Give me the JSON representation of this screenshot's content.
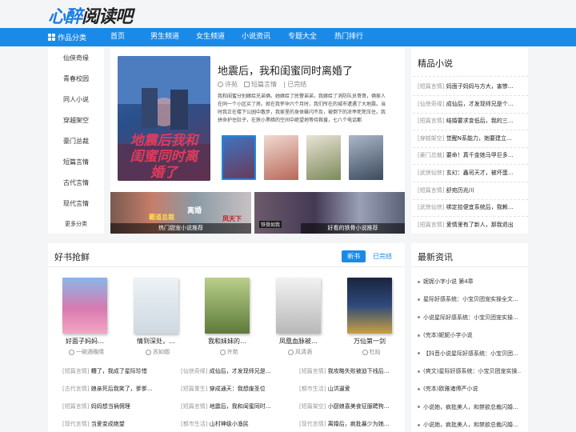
{
  "logo": {
    "part1": "心醉",
    "part2": "阅读吧"
  },
  "nav": {
    "category": "作品分类",
    "items": [
      "首页",
      "男生频道",
      "女生频道",
      "小说资讯",
      "专题大全",
      "热门排行"
    ]
  },
  "sidebar": {
    "items": [
      "仙侠奇缘",
      "青春校园",
      "同人小说",
      "穿越架空",
      "豪门总裁",
      "短篇言情",
      "古代言情",
      "现代言情",
      "更多分类"
    ]
  },
  "hero": {
    "title": "地震后，我和闺蜜同时离婚了",
    "author": "许苑",
    "category": "短篇言情",
    "status": "已完结",
    "desc": "我和闺蜜分别嫁给兄弟俩。她嫁给了民警弟弟，我嫁给了消防队员哥哥，俩家人在同一个小区买了房。就在我怀孕六个月时，我们所在的城市遭遇了大地震。当时我正在楼下公园中散步，我家里的身体躲闪不及，被倒下的凉亭死死压住。我拼命护住肚子，在狭小黑暗的空间中绝望地等待救援，七八个电话都",
    "cover_text": "地震后我和闺蜜同时离婚了"
  },
  "banners": [
    {
      "caption": "热门甜宠小说推荐"
    },
    {
      "caption": "好看的铁骨小说推荐"
    }
  ],
  "banner_labels": {
    "a": "霸道总裁",
    "b": "离婚",
    "c": "凤天下",
    "d": "铁骨如我"
  },
  "featured": {
    "title": "精品小说",
    "items": [
      {
        "tag": "[短篇言情]",
        "text": "妈面子妈妈与方大，害惨…"
      },
      {
        "tag": "[仙侠奇缘]",
        "text": "成仙后，才发现师兄是个…"
      },
      {
        "tag": "[短篇言情]",
        "text": "结婚要求变低后，我的三…"
      },
      {
        "tag": "[穿越架空]",
        "text": "觉醒N系能力，她要建立…"
      },
      {
        "tag": "[豪门总裁]",
        "text": "要命！真千金她马甲巨多…"
      },
      {
        "tag": "[武侠仙侠]",
        "text": "玄幻：鑫司天才，被坏蛋…"
      },
      {
        "tag": "[短篇言情]",
        "text": "舒宛历兆川"
      },
      {
        "tag": "[武侠仙侠]",
        "text": "绑定拾便宜系统后，我赖…"
      },
      {
        "tag": "[短篇言情]",
        "text": "爱情里有了新人，那我退出"
      }
    ]
  },
  "good_books": {
    "title": "好书抢鲜",
    "tabs": [
      "新书",
      "已完结"
    ],
    "books": [
      {
        "title": "好面子妈妈…",
        "author": "一碗酒晚晴"
      },
      {
        "title": "情到深处，…",
        "author": "苏如烟"
      },
      {
        "title": "我和妹妹的…",
        "author": "许苑"
      },
      {
        "title": "凤凰血脉被…",
        "author": "风清酒"
      },
      {
        "title": "万仙第一剑",
        "author": "杜灿"
      }
    ],
    "list": [
      {
        "tag": "[短篇言情]",
        "text": "糟了，我成了星际珍惜"
      },
      {
        "tag": "[仙侠奇缘]",
        "text": "成仙后，才发现师兄是…"
      },
      {
        "tag": "[短篇言情]",
        "text": "我攻略失败被迫下线后…"
      },
      {
        "tag": "[古代言情]",
        "text": "娘亲死后我笑了，爹爹…"
      },
      {
        "tag": "[短篇重生]",
        "text": "穿成通天：我想废圣位"
      },
      {
        "tag": "[都市生活]",
        "text": "山洪逼爱"
      },
      {
        "tag": "[短篇言情]",
        "text": "妈妈想当祸佣理"
      },
      {
        "tag": "[短篇言情]",
        "text": "地震后，我和闺蜜同时…"
      },
      {
        "tag": "[短篇架空]",
        "text": "小厨娘喜美食征服聘狗…"
      },
      {
        "tag": "[现代言情]",
        "text": "当爱变成绝望"
      },
      {
        "tag": "[都市生活]",
        "text": "山村神级小渔民"
      },
      {
        "tag": "[现代言情]",
        "text": "离婚后，疯批暴少为她…"
      }
    ]
  },
  "news": {
    "title": "最新资讯",
    "items": [
      "妮妮小字小说 第4章",
      "星际好感系统：小宝贝团宠实操全文…",
      "小说星际好感系统：小宝贝团宠实操…",
      "(完本)妮妮小字小说",
      "【抖音小说星际好感系统：小宝贝团…",
      "(爽文)星际好感系统：小宝贝团宠实操…",
      "(完本)欧雅诸傅严小说",
      "小说她，疯批美人，和禁欲总裁闪婚…",
      "小说她，疯批美人，和禁欲总裁闪婚…"
    ]
  }
}
